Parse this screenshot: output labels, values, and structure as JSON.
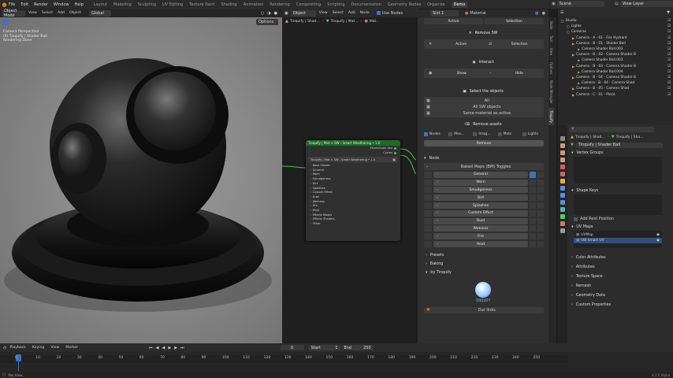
{
  "topbar": {
    "menus": [
      "File",
      "Edit",
      "Render",
      "Window",
      "Help"
    ],
    "workspaces": [
      "Layout",
      "Modeling",
      "Sculpting",
      "UV Editing",
      "Texture Paint",
      "Shading",
      "Animation",
      "Rendering",
      "Compositing",
      "Scripting",
      "Documentation",
      "Geometry Nodes",
      "Organize",
      "Demo"
    ],
    "active_workspace": "Demo",
    "scene": "Scene",
    "view_layer": "View Layer"
  },
  "viewport": {
    "mode": "Object Mode",
    "menus": [
      "View",
      "Select",
      "Add",
      "Object"
    ],
    "orientation": "Global",
    "options": "Options",
    "overlay_lines": [
      "Camera Perspective",
      "(0) Tinquify | Shader Ball",
      "Rendering Done"
    ]
  },
  "node_editor": {
    "type": "Object",
    "menus": [
      "View",
      "Select",
      "Add",
      "Node"
    ],
    "use_nodes": "Use Nodes",
    "slot": "Slot 1",
    "material": "Material",
    "breadcrumb": [
      "Tinquify | Shad...",
      "Tinquify | Mat...",
      "Mat..."
    ],
    "node": {
      "title": "Tinquify | Mat > SW - Smart Weathering • 1.0",
      "out1": "Eevee/Look dev",
      "out2": "Cycles",
      "subtitle": "Tinquify | Mat > SW - Smart Weathering • 1.0",
      "items": [
        "Base Shader",
        "General",
        "Worn",
        "Smudgeness",
        "Dirt",
        "Splashes",
        "Custom Effect",
        "Dust",
        "Wetness",
        "Fire",
        "Heat",
        "Effects Masks",
        "Effects Shaders",
        "Other"
      ]
    }
  },
  "npanel": {
    "top_active": "Active",
    "top_selection": "Selection",
    "remove_sw": "Remove SW",
    "rs_active": "Active",
    "rs_selection": "Selection",
    "interact": "Interact",
    "show": "Show",
    "hide": "Hide",
    "select_objects": "Select the objects",
    "all": "All",
    "all_sw": "All SW objects",
    "same_material": "Same material as active",
    "remove_assets": "Remove assets",
    "asset_types": [
      "Nodes",
      "Mes...",
      "Imag...",
      "Mats",
      "Lights"
    ],
    "remove": "Remove",
    "node_section": "Node",
    "baked_maps": "Baked Maps (BM) Toggles",
    "bake_rows": [
      "General",
      "Worn",
      "Smudgeness",
      "Dirt",
      "Splashes",
      "Custom Effect",
      "Dust",
      "Wetness",
      "Fire",
      "Heat"
    ],
    "presets": "Presets",
    "baking": "Baking",
    "by": "by Tinquify",
    "logo_text": "TINQUIFY",
    "links": "Our links",
    "tabs": [
      "Node",
      "Tool",
      "View",
      "Options",
      "Node Wrangler",
      "Tinquify"
    ]
  },
  "outliner": {
    "rows": [
      {
        "indent": 0,
        "label": "Studio"
      },
      {
        "indent": 1,
        "label": "Lights"
      },
      {
        "indent": 1,
        "label": "Cameras"
      },
      {
        "indent": 2,
        "label": "Camera - A - 01 - Fire Hydrant"
      },
      {
        "indent": 2,
        "label": "Camera - B - 01 - Shader Ball"
      },
      {
        "indent": 3,
        "label": "Camera Shader Ball.003"
      },
      {
        "indent": 2,
        "label": "Camera - B - 02 - Camera Shader B"
      },
      {
        "indent": 3,
        "label": "Camera Shader Ball.003"
      },
      {
        "indent": 2,
        "label": "Camera - B - 03 - Camera Shader B"
      },
      {
        "indent": 3,
        "label": "Camera Shader Ball.004"
      },
      {
        "indent": 2,
        "label": "Camera - B - 04 - Camera Shader B"
      },
      {
        "indent": 3,
        "label": "Camera - B - 04 - Camera Shad"
      },
      {
        "indent": 2,
        "label": "Camera - B - 05 - Camera Shad"
      },
      {
        "indent": 2,
        "label": "Camera - C - 01 - Piece"
      }
    ]
  },
  "properties": {
    "breadcrumb": [
      "Tinquify | Shad...",
      "Tinquify | Sha..."
    ],
    "object_name": "Tinquify | Shader Ball",
    "vertex_groups": "Vertex Groups",
    "shape_keys": "Shape Keys",
    "add_rest": "Add Rest Position",
    "uv_maps": "UV Maps",
    "uv_list": [
      "UVMap",
      "SW Smart UV"
    ],
    "collapsed": [
      "Color Attributes",
      "Attributes",
      "Texture Space",
      "Remesh",
      "Geometry Data",
      "Custom Properties"
    ]
  },
  "timeline": {
    "menus": [
      "Playback",
      "Keying",
      "View",
      "Marker"
    ],
    "current_frame": "0",
    "start_label": "Start",
    "start": "1",
    "end_label": "End",
    "end": "250",
    "ticks": [
      "0",
      "10",
      "20",
      "30",
      "40",
      "50",
      "60",
      "70",
      "80",
      "90",
      "100",
      "110",
      "120",
      "130",
      "140",
      "150",
      "160",
      "170",
      "180",
      "190",
      "200",
      "210",
      "220",
      "230",
      "240",
      "250"
    ],
    "status_left": "Pan View",
    "version": "4.2.0 Alpha"
  },
  "colors": {
    "accent_orange": "#e87d0d",
    "selection_blue": "#4772b3",
    "node_header_green": "#1f6b2a",
    "node_link_green": "#50c050"
  }
}
